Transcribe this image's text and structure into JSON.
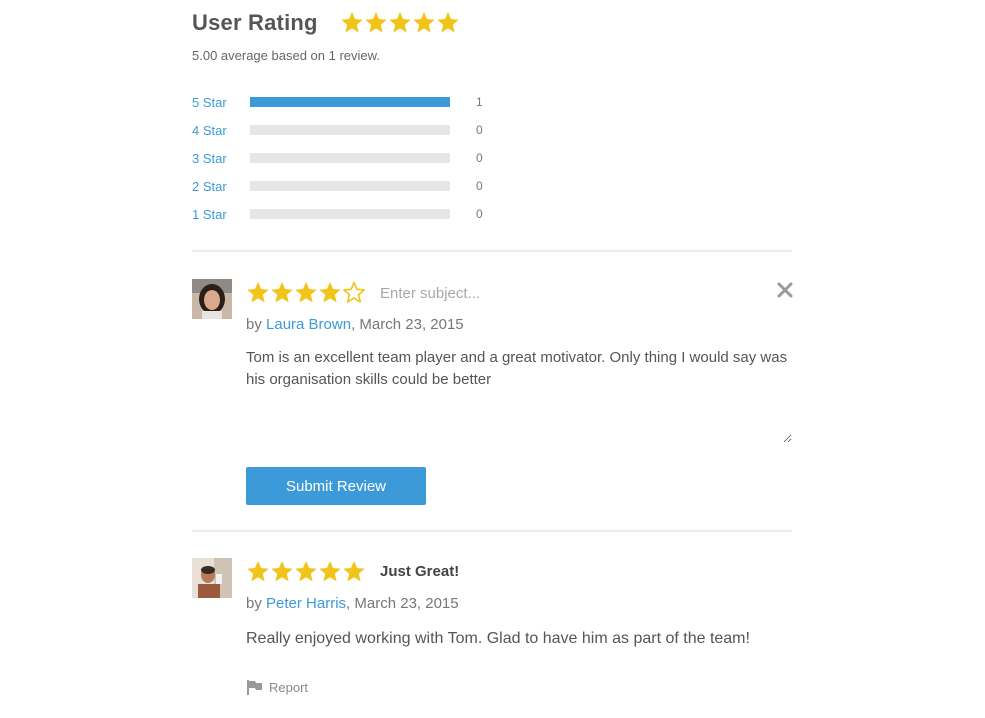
{
  "colors": {
    "accent": "#3d9ad8",
    "star": "#f0c419",
    "bar_empty": "#e6e6e6"
  },
  "summary": {
    "title": "User Rating",
    "rating": 5,
    "average_text": "5.00 average based on 1 review."
  },
  "histogram": [
    {
      "label": "5 Star",
      "count": "1",
      "fraction": 1.0
    },
    {
      "label": "4 Star",
      "count": "0",
      "fraction": 0.0
    },
    {
      "label": "3 Star",
      "count": "0",
      "fraction": 0.0
    },
    {
      "label": "2 Star",
      "count": "0",
      "fraction": 0.0
    },
    {
      "label": "1 Star",
      "count": "0",
      "fraction": 0.0
    }
  ],
  "draft_review": {
    "rating": 4,
    "subject_placeholder": "Enter subject...",
    "by": "by",
    "author": "Laura Brown",
    "date": ", March 23, 2015",
    "body": "Tom is an excellent team player and a great motivator. Only thing I would say was his organisation skills could be better",
    "submit_label": "Submit Review",
    "close_icon": "close-icon"
  },
  "published_review": {
    "rating": 5,
    "title": "Just Great!",
    "by": "by",
    "author": "Peter Harris",
    "date": ", March 23, 2015",
    "body": "Really enjoyed working with Tom. Glad to have him as part of the team!",
    "report_label": "Report",
    "report_icon": "flag-icon"
  }
}
